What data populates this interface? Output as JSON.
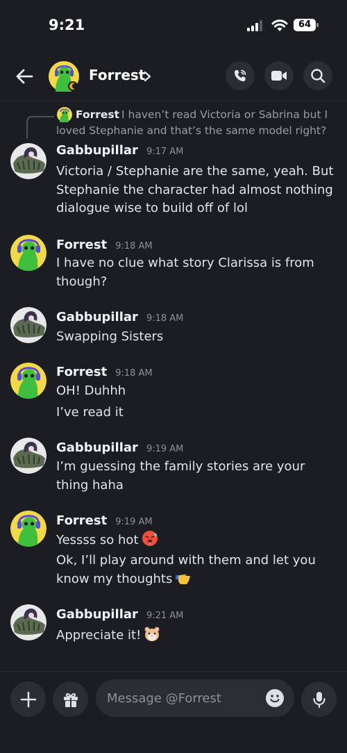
{
  "status_bar": {
    "time": "9:21",
    "battery": "64"
  },
  "header": {
    "name": "Forrest",
    "chevron": ">"
  },
  "reply": {
    "author": "Forrest",
    "text": "I haven’t read Victoria or Sabrina but I loved Stephanie and that’s the same model right? ..."
  },
  "messages": [
    {
      "author": "Gabbupillar",
      "time": "9:17 AM",
      "lines": [
        "Victoria / Stephanie are the same, yeah. But Stephanie the character had almost nothing dialogue wise to build off of lol"
      ]
    },
    {
      "author": "Forrest",
      "time": "9:18 AM",
      "lines": [
        "I have no clue what story Clarissa is from though?"
      ]
    },
    {
      "author": "Gabbupillar",
      "time": "9:18 AM",
      "lines": [
        "Swapping Sisters"
      ]
    },
    {
      "author": "Forrest",
      "time": "9:18 AM",
      "lines": [
        "OH! Duhhh",
        "I’ve read it"
      ]
    },
    {
      "author": "Gabbupillar",
      "time": "9:19 AM",
      "lines": [
        "I’m guessing the family stories are your thing haha"
      ]
    },
    {
      "author": "Forrest",
      "time": "9:19 AM",
      "lines": [
        "Yessss so hot",
        "Ok, I’ll play around with them and let you know my thoughts"
      ]
    },
    {
      "author": "Gabbupillar",
      "time": "9:21 AM",
      "lines": [
        "Appreciate it!"
      ]
    }
  ],
  "composer": {
    "placeholder": "Message @Forrest"
  },
  "icons": {
    "back": "arrow-left-icon",
    "call": "phone-icon",
    "video": "video-camera-icon",
    "search": "search-icon",
    "add": "plus-icon",
    "gift": "gift-icon",
    "emoji": "smile-icon",
    "mic": "microphone-icon"
  },
  "colors": {
    "background": "#1c1d22",
    "surface": "#2b2d34",
    "text": "#e3e4e8",
    "muted": "#8e9099"
  }
}
